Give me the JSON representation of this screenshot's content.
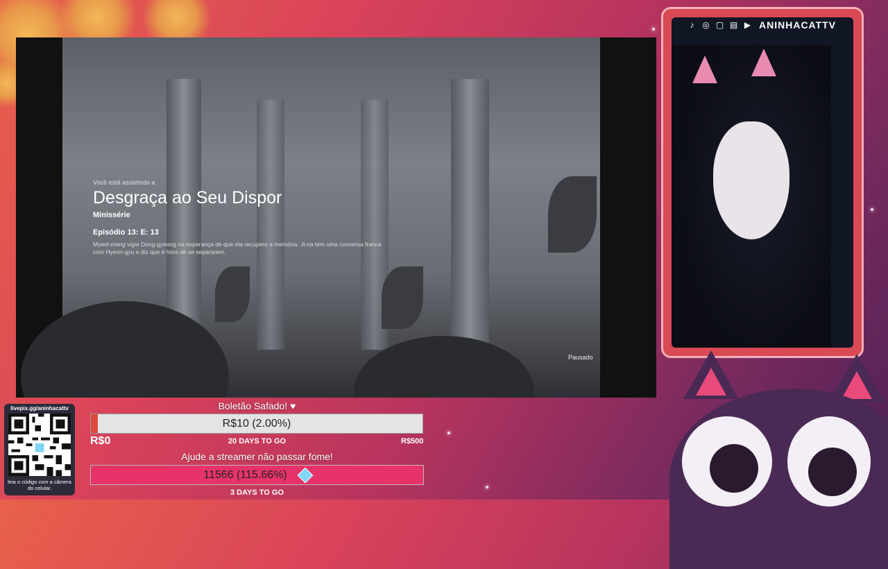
{
  "video": {
    "watching_label": "Você está assistindo a",
    "title": "Desgraça ao Seu Dispor",
    "type": "Minissérie",
    "episode": "Episódio 13: E: 13",
    "description": "Myeol-mang vigia Dong-gyeong na esperança de que ela recupere a memória. Ji-na tem uma conversa franca com Hyeon-gyu e diz que é hora de se separarem.",
    "status": "Pausado"
  },
  "webcam": {
    "channel_name": "ANINHACATTV",
    "social_icons": [
      "tiktok-icon",
      "discord-icon",
      "instagram-icon",
      "twitch-icon",
      "youtube-icon"
    ]
  },
  "qr": {
    "url": "livepix.gg/aninhacattv",
    "footer": "leia o código com a câmera do celular."
  },
  "goal1": {
    "title": "Boletão Safado! ♥",
    "value_text": "R$10 (2.00%)",
    "progress": 0.02,
    "min_label": "R$0",
    "days_label": "20 DAYS TO GO",
    "max_label": "R$500"
  },
  "goal2": {
    "title": "Ajude a streamer não passar fome!",
    "value_text": "11566 (115.66%)",
    "progress": 1.0,
    "days_label": "3 DAYS TO GO"
  },
  "colors": {
    "accent": "#e8336a",
    "frame": "#d94a55",
    "bar1_fill": "#e0483e"
  }
}
